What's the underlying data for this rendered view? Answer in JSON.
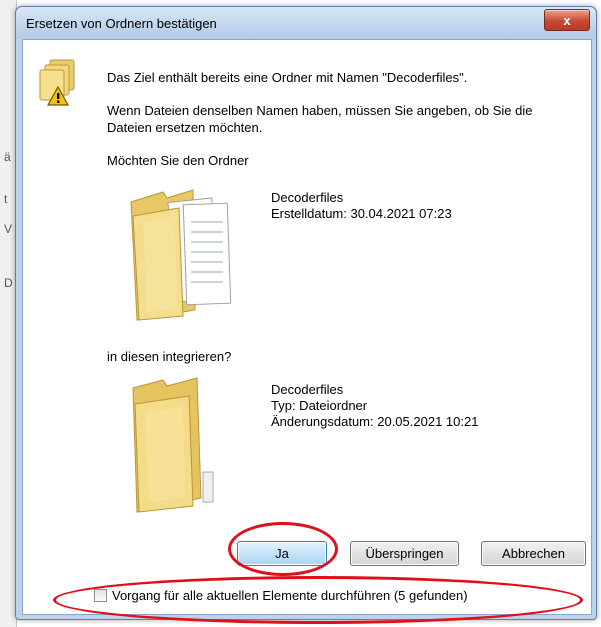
{
  "dialog": {
    "title": "Ersetzen von Ordnern bestätigen",
    "close_label": "x",
    "message1": "Das Ziel enthält bereits eine Ordner mit Namen \"Decoderfiles\".",
    "message2a": "Wenn Dateien denselben Namen haben, müssen Sie angeben, ob Sie die",
    "message2b": "Dateien ersetzen möchten.",
    "question1": "Möchten Sie den Ordner",
    "source": {
      "name": "Decoderfiles",
      "created": "Erstelldatum: 30.04.2021 07:23"
    },
    "question2": "in diesen integrieren?",
    "target": {
      "name": "Decoderfiles",
      "type": "Typ: Dateiordner",
      "modified": "Änderungsdatum: 20.05.2021 10:21"
    },
    "buttons": {
      "yes": "Ja",
      "skip": "Überspringen",
      "cancel": "Abbrechen"
    },
    "checkbox_label": "Vorgang für alle aktuellen Elemente durchführen (5 gefunden)"
  },
  "background_fragments": [
    "ä",
    "t",
    "V",
    "D"
  ],
  "colors": {
    "annotation_red": "#e0101a",
    "titlebar_blue": "#bcd3ec",
    "close_red": "#c74b35"
  }
}
